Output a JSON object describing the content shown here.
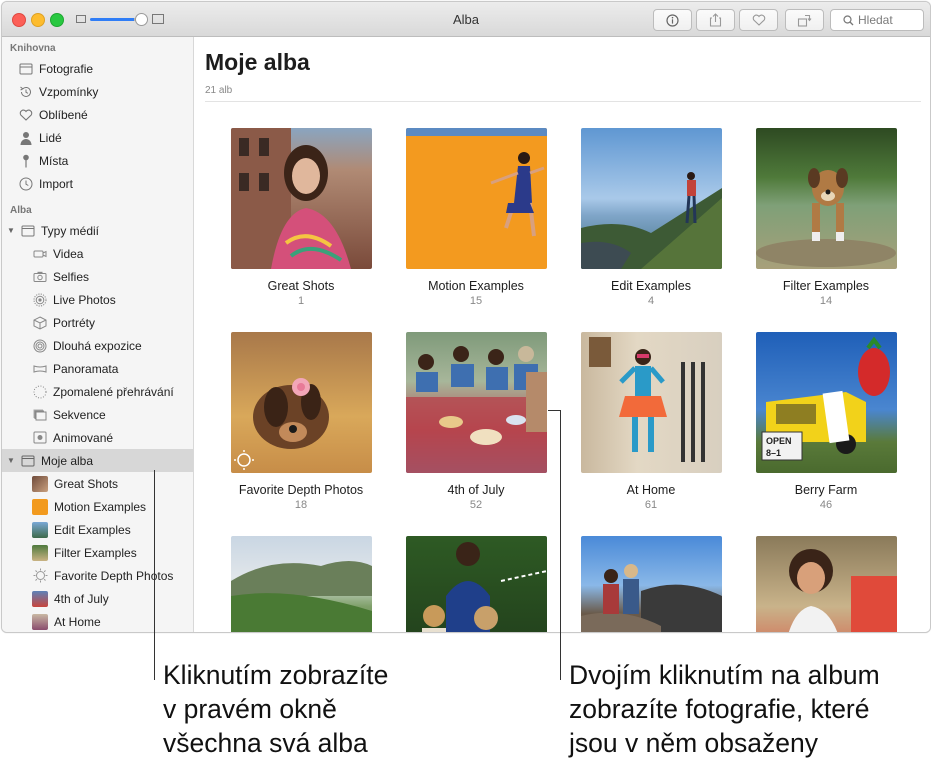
{
  "window": {
    "title": "Alba"
  },
  "toolbar": {
    "search_placeholder": "Hledat",
    "buttons": [
      "info-icon",
      "share-icon",
      "heart-icon",
      "rotate-icon"
    ]
  },
  "sidebar": {
    "library_header": "Knihovna",
    "library_items": [
      {
        "label": "Fotografie",
        "icon": "photos-icon"
      },
      {
        "label": "Vzpomínky",
        "icon": "memories-icon"
      },
      {
        "label": "Oblíbené",
        "icon": "heart-icon"
      },
      {
        "label": "Lidé",
        "icon": "person-icon"
      },
      {
        "label": "Místa",
        "icon": "pin-icon"
      },
      {
        "label": "Import",
        "icon": "clock-icon"
      }
    ],
    "albums_header": "Alba",
    "media_types": {
      "label": "Typy médií",
      "items": [
        {
          "label": "Videa",
          "icon": "video-icon"
        },
        {
          "label": "Selfies",
          "icon": "camera-icon"
        },
        {
          "label": "Live Photos",
          "icon": "live-photo-icon"
        },
        {
          "label": "Portréty",
          "icon": "cube-icon"
        },
        {
          "label": "Dlouhá expozice",
          "icon": "long-exposure-icon"
        },
        {
          "label": "Panoramata",
          "icon": "panorama-icon"
        },
        {
          "label": "Zpomalené přehrávání",
          "icon": "slomo-icon"
        },
        {
          "label": "Sekvence",
          "icon": "burst-icon"
        },
        {
          "label": "Animované",
          "icon": "animated-icon"
        }
      ]
    },
    "my_albums": {
      "label": "Moje alba",
      "items": [
        {
          "label": "Great Shots",
          "color": "#8a5a44"
        },
        {
          "label": "Motion Examples",
          "color": "#f29a1e"
        },
        {
          "label": "Edit Examples",
          "color": "#4f7fb1"
        },
        {
          "label": "Filter Examples",
          "color": "#6b8a4e"
        },
        {
          "label": "Favorite Depth Photos",
          "color": "#c8c8c8"
        },
        {
          "label": "4th of July",
          "color": "#4a6fa5"
        },
        {
          "label": "At Home",
          "color": "#b57a62"
        }
      ]
    }
  },
  "main": {
    "title": "Moje alba",
    "subtitle": "21 alb",
    "albums": [
      {
        "name": "Great Shots",
        "count": "1"
      },
      {
        "name": "Motion Examples",
        "count": "15"
      },
      {
        "name": "Edit Examples",
        "count": "4"
      },
      {
        "name": "Filter Examples",
        "count": "14"
      },
      {
        "name": "Favorite Depth Photos",
        "count": "18"
      },
      {
        "name": "4th of July",
        "count": "52"
      },
      {
        "name": "At Home",
        "count": "61"
      },
      {
        "name": "Berry Farm",
        "count": "46"
      },
      {
        "name": "",
        "count": ""
      },
      {
        "name": "",
        "count": ""
      },
      {
        "name": "",
        "count": ""
      },
      {
        "name": "",
        "count": ""
      }
    ]
  },
  "callouts": {
    "left": "Kliknutím zobrazíte\nv pravém okně\nvšechna svá alba",
    "right": "Dvojím kliknutím na album\nzobrazíte fotografie, které\njsou v něm obsaženy"
  },
  "colors": {
    "accent": "#2f7df6",
    "selection": "#d7d7d7"
  }
}
